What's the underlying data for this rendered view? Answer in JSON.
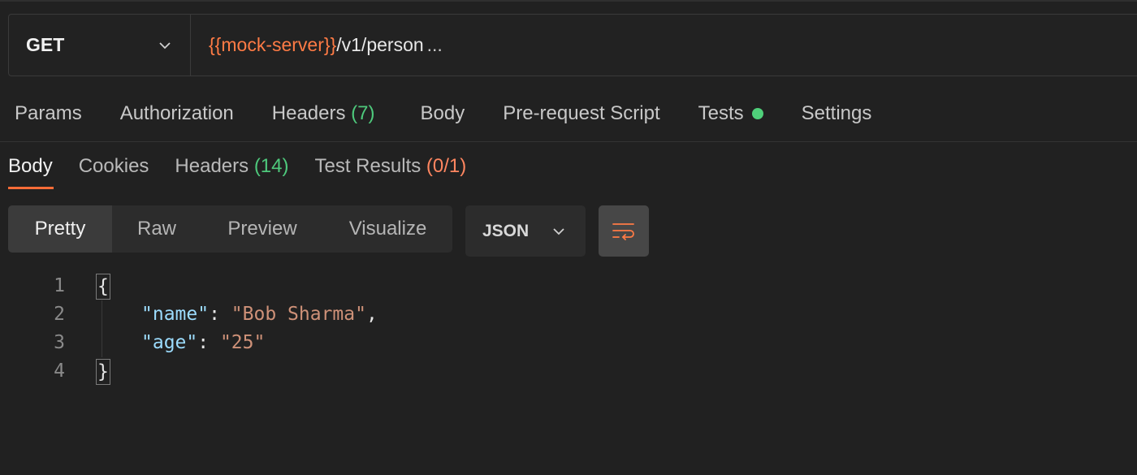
{
  "request": {
    "method": "GET",
    "url_variable": "{{mock-server}}",
    "url_path": "/v1/person",
    "url_ellipsis": "..."
  },
  "request_tabs": [
    {
      "label": "Params"
    },
    {
      "label": "Authorization"
    },
    {
      "label": "Headers",
      "count": "(7)"
    },
    {
      "label": "Body"
    },
    {
      "label": "Pre-request Script"
    },
    {
      "label": "Tests"
    },
    {
      "label": "Settings"
    }
  ],
  "response_tabs": [
    {
      "label": "Body"
    },
    {
      "label": "Cookies"
    },
    {
      "label": "Headers",
      "count": "(14)"
    },
    {
      "label": "Test Results",
      "count": "(0/1)"
    }
  ],
  "view_modes": [
    "Pretty",
    "Raw",
    "Preview",
    "Visualize"
  ],
  "format": "JSON",
  "code_lines": {
    "l1": {
      "num": "1",
      "text": "{"
    },
    "l2": {
      "num": "2",
      "key": "\"name\"",
      "sep": ": ",
      "value": "\"Bob Sharma\"",
      "trail": ","
    },
    "l3": {
      "num": "3",
      "key": "\"age\"",
      "sep": ": ",
      "value": "\"25\"",
      "trail": ""
    },
    "l4": {
      "num": "4",
      "text": "}"
    }
  },
  "colors": {
    "accent": "#ff6c37",
    "variable": "#ff7b45",
    "count_green": "#4ec97c",
    "count_orange": "#ff8660",
    "json_key": "#9cdcfe",
    "json_string": "#ce9178"
  }
}
